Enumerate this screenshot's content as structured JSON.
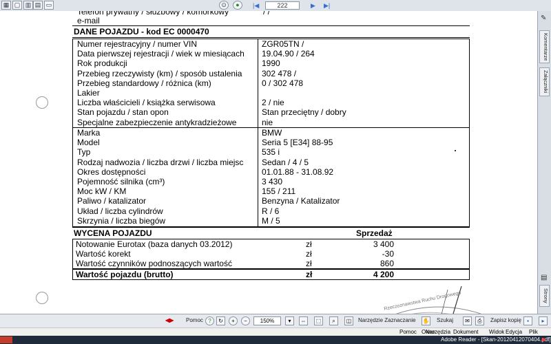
{
  "toolbar": {
    "page_value": "222",
    "page_total": "/ 7"
  },
  "right_panel": {
    "tabs": [
      "Komentarze",
      "Załączniki",
      "Strony"
    ]
  },
  "document": {
    "top_rows": [
      {
        "label": "Telefon prywatny / służbowy / komórkowy",
        "value": "/ /"
      },
      {
        "label": "e-mail",
        "value": ""
      }
    ],
    "section_title": "DANE POJAZDU - kod EC 0000470",
    "group1": [
      {
        "label": "Numer rejestracyjny / numer VIN",
        "value": "ZGR05TN /"
      },
      {
        "label": "Data pierwszej rejestracji / wiek w miesiącach",
        "value": "19.04.90 / 264"
      },
      {
        "label": "Rok produkcji",
        "value": "1990"
      },
      {
        "label": "Przebieg rzeczywisty (km) / sposób ustalenia",
        "value": "302 478 /"
      },
      {
        "label": "Przebieg standardowy / różnica (km)",
        "value": "0 / 302 478"
      },
      {
        "label": "Lakier",
        "value": ""
      },
      {
        "label": "Liczba właścicieli / książka serwisowa",
        "value": "2 / nie"
      },
      {
        "label": "Stan pojazdu / stan opon",
        "value": "Stan przeciętny / dobry"
      },
      {
        "label": "Specjalne zabezpieczenie antykradzieżowe",
        "value": "nie"
      }
    ],
    "group2": [
      {
        "label": "Marka",
        "value": "BMW"
      },
      {
        "label": "Model",
        "value": "Seria 5 [E34] 88-95"
      },
      {
        "label": "Typ",
        "value": "535 i"
      },
      {
        "label": "Rodzaj nadwozia / liczba drzwi / liczba miejsc",
        "value": "Sedan / 4 / 5"
      },
      {
        "label": "Okres dostępności",
        "value": "01.01.88 - 31.08.92"
      },
      {
        "label": "Pojemność silnika (cm³)",
        "value": "3 430"
      },
      {
        "label": "Moc kW / KM",
        "value": "155 / 211"
      },
      {
        "label": "Paliwo / katalizator",
        "value": "Benzyna / Katalizator"
      },
      {
        "label": "Układ / liczba cylindrów",
        "value": "R / 6"
      },
      {
        "label": "Skrzynia / liczba biegów",
        "value": "M / 5"
      }
    ],
    "valuation": {
      "title": "WYCENA POJAZDU",
      "column_header": "Sprzedaż",
      "rows": [
        {
          "label": "Notowanie Eurotax (baza danych 03.2012)",
          "currency": "zł",
          "value": "3 400"
        },
        {
          "label": "Wartość korekt",
          "currency": "zł",
          "value": "-30"
        },
        {
          "label": "Wartość czynników podnoszących wartość",
          "currency": "zł",
          "value": "860"
        }
      ],
      "total": {
        "label": "Wartość pojazdu (brutto)",
        "currency": "zł",
        "value": "4 200"
      }
    },
    "stamp_text": "Rzeczoznawstwa Ruchu Drogowego"
  },
  "bottom_toolbar": {
    "save_copy": "Zapisz kopię",
    "search": "Szukaj",
    "select_tool": "Narzędzie Zaznaczanie",
    "zoom": "150%",
    "help": "Pomoc"
  },
  "menu": [
    "Plik",
    "Edycja",
    "Widok",
    "Dokument",
    "Narzędzia",
    "Okno",
    "Pomoc"
  ],
  "window": {
    "title": "Adobe Reader - [Skan-20120412070404.pdf]"
  }
}
